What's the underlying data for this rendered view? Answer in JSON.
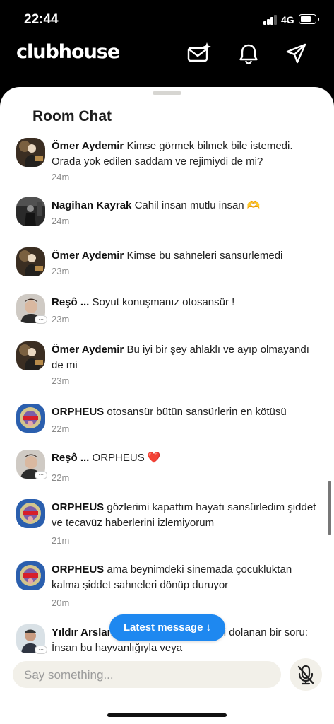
{
  "status": {
    "time": "22:44",
    "network": "4G",
    "battery_level": 0.75
  },
  "header": {
    "app_name": "clubhouse"
  },
  "room_chat": {
    "title": "Room Chat",
    "messages": [
      {
        "author": "Ömer Aydemir",
        "text": "Kimse görmek bilmek bile istemedi. Orada yok edilen saddam ve rejimiydi de mi?",
        "time": "24m"
      },
      {
        "author": "Nagihan Kayrak",
        "text": "Cahil insan mutlu insan 🫶",
        "time": "24m"
      },
      {
        "author": "Ömer Aydemir",
        "text": "Kimse bu sahneleri sansürlemedi",
        "time": "23m"
      },
      {
        "author": "Reşô ...",
        "text": "Soyut konuşmanız otosansür !",
        "time": "23m"
      },
      {
        "author": "Ömer Aydemir",
        "text": "Bu iyi bir şey ahlaklı ve ayıp olmayandı de mi",
        "time": "23m"
      },
      {
        "author": "ORPHEUS",
        "text": "otosansür bütün sansürlerin en kötüsü",
        "time": "22m"
      },
      {
        "author": "Reşô ...",
        "text": "ORPHEUS ❤️",
        "time": "22m"
      },
      {
        "author": "ORPHEUS",
        "text": "gözlerimi kapattım hayatı sansürledim şiddet ve tecavüz haberlerini izlemiyorum",
        "time": "21m"
      },
      {
        "author": "ORPHEUS",
        "text": "ama beynimdeki sinemada çocukluktan kalma şiddet sahneleri dönüp duruyor",
        "time": "20m"
      },
      {
        "author": "Yıldır Arslan",
        "text": "Sürekli kafamda sürekli dolanan bir soru: İnsan bu hayvanlığıyla  veya",
        "time": ""
      }
    ],
    "latest_button": "Latest message ↓",
    "input_placeholder": "Say something...",
    "avatar_more": "···"
  },
  "colors": {
    "accent": "#1e88f0",
    "sheet": "#ffffff",
    "input_bg": "#f2f0e9"
  },
  "icons": [
    "new-message-icon",
    "notification-bell-icon",
    "send-invite-icon",
    "muted-mic-icon"
  ]
}
